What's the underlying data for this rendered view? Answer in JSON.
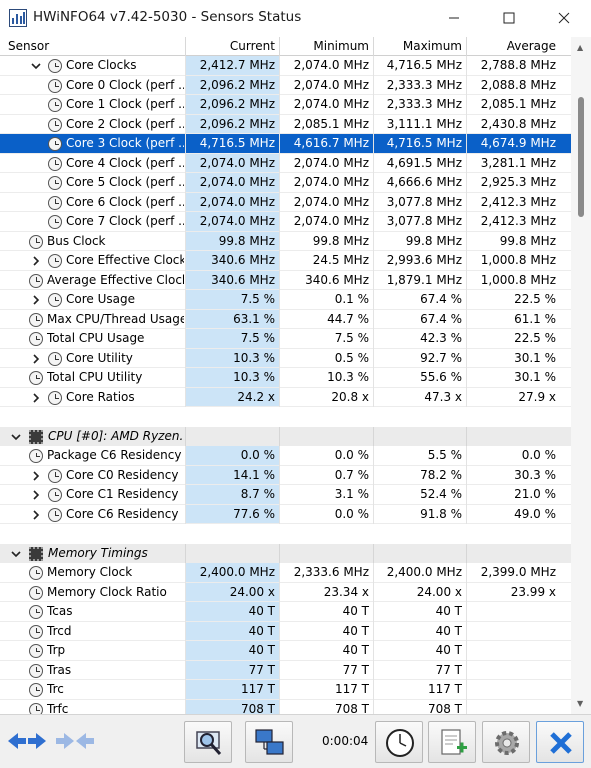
{
  "window": {
    "title": "HWiNFO64 v7.42-5030 - Sensors Status",
    "minimize_icon": "minimize-icon",
    "maximize_icon": "maximize-icon",
    "close_icon": "close-icon"
  },
  "columns": {
    "sensor": "Sensor",
    "current": "Current",
    "minimum": "Minimum",
    "maximum": "Maximum",
    "average": "Average"
  },
  "rows": [
    {
      "type": "sensor",
      "indent": 1,
      "expander": "open",
      "icon": "clock-sensor-icon",
      "name": "Core Clocks",
      "current": "2,412.7 MHz",
      "minimum": "2,074.0 MHz",
      "maximum": "4,716.5 MHz",
      "average": "2,788.8 MHz"
    },
    {
      "type": "sensor",
      "indent": 2,
      "expander": "",
      "icon": "clock-sensor-icon",
      "name": "Core 0 Clock (perf ...",
      "current": "2,096.2 MHz",
      "minimum": "2,074.0 MHz",
      "maximum": "2,333.3 MHz",
      "average": "2,088.8 MHz"
    },
    {
      "type": "sensor",
      "indent": 2,
      "expander": "",
      "icon": "clock-sensor-icon",
      "name": "Core 1 Clock (perf ...",
      "current": "2,096.2 MHz",
      "minimum": "2,074.0 MHz",
      "maximum": "2,333.3 MHz",
      "average": "2,085.1 MHz"
    },
    {
      "type": "sensor",
      "indent": 2,
      "expander": "",
      "icon": "clock-sensor-icon",
      "name": "Core 2 Clock (perf ...",
      "current": "2,096.2 MHz",
      "minimum": "2,085.1 MHz",
      "maximum": "3,111.1 MHz",
      "average": "2,430.8 MHz"
    },
    {
      "type": "sensor",
      "indent": 2,
      "expander": "",
      "icon": "clock-sensor-icon",
      "name": "Core 3 Clock (perf ...",
      "current": "4,716.5 MHz",
      "minimum": "4,616.7 MHz",
      "maximum": "4,716.5 MHz",
      "average": "4,674.9 MHz",
      "selected": true
    },
    {
      "type": "sensor",
      "indent": 2,
      "expander": "",
      "icon": "clock-sensor-icon",
      "name": "Core 4 Clock (perf ...",
      "current": "2,074.0 MHz",
      "minimum": "2,074.0 MHz",
      "maximum": "4,691.5 MHz",
      "average": "3,281.1 MHz"
    },
    {
      "type": "sensor",
      "indent": 2,
      "expander": "",
      "icon": "clock-sensor-icon",
      "name": "Core 5 Clock (perf ...",
      "current": "2,074.0 MHz",
      "minimum": "2,074.0 MHz",
      "maximum": "4,666.6 MHz",
      "average": "2,925.3 MHz"
    },
    {
      "type": "sensor",
      "indent": 2,
      "expander": "",
      "icon": "clock-sensor-icon",
      "name": "Core 6 Clock (perf ...",
      "current": "2,074.0 MHz",
      "minimum": "2,074.0 MHz",
      "maximum": "3,077.8 MHz",
      "average": "2,412.3 MHz"
    },
    {
      "type": "sensor",
      "indent": 2,
      "expander": "",
      "icon": "clock-sensor-icon",
      "name": "Core 7 Clock (perf ...",
      "current": "2,074.0 MHz",
      "minimum": "2,074.0 MHz",
      "maximum": "3,077.8 MHz",
      "average": "2,412.3 MHz"
    },
    {
      "type": "sensor",
      "indent": 0,
      "expander": "",
      "icon": "clock-sensor-icon",
      "name": "Bus Clock",
      "current": "99.8 MHz",
      "minimum": "99.8 MHz",
      "maximum": "99.8 MHz",
      "average": "99.8 MHz"
    },
    {
      "type": "sensor",
      "indent": 1,
      "expander": "closed",
      "icon": "clock-sensor-icon",
      "name": "Core Effective Clocks",
      "current": "340.6 MHz",
      "minimum": "24.5 MHz",
      "maximum": "2,993.6 MHz",
      "average": "1,000.8 MHz"
    },
    {
      "type": "sensor",
      "indent": 0,
      "expander": "",
      "icon": "clock-sensor-icon",
      "name": "Average Effective Clock",
      "current": "340.6 MHz",
      "minimum": "340.6 MHz",
      "maximum": "1,879.1 MHz",
      "average": "1,000.8 MHz"
    },
    {
      "type": "sensor",
      "indent": 1,
      "expander": "closed",
      "icon": "clock-sensor-icon",
      "name": "Core Usage",
      "current": "7.5 %",
      "minimum": "0.1 %",
      "maximum": "67.4 %",
      "average": "22.5 %"
    },
    {
      "type": "sensor",
      "indent": 0,
      "expander": "",
      "icon": "clock-sensor-icon",
      "name": "Max CPU/Thread Usage",
      "current": "63.1 %",
      "minimum": "44.7 %",
      "maximum": "67.4 %",
      "average": "61.1 %"
    },
    {
      "type": "sensor",
      "indent": 0,
      "expander": "",
      "icon": "clock-sensor-icon",
      "name": "Total CPU Usage",
      "current": "7.5 %",
      "minimum": "7.5 %",
      "maximum": "42.3 %",
      "average": "22.5 %"
    },
    {
      "type": "sensor",
      "indent": 1,
      "expander": "closed",
      "icon": "clock-sensor-icon",
      "name": "Core Utility",
      "current": "10.3 %",
      "minimum": "0.5 %",
      "maximum": "92.7 %",
      "average": "30.1 %"
    },
    {
      "type": "sensor",
      "indent": 0,
      "expander": "",
      "icon": "clock-sensor-icon",
      "name": "Total CPU Utility",
      "current": "10.3 %",
      "minimum": "10.3 %",
      "maximum": "55.6 %",
      "average": "30.1 %"
    },
    {
      "type": "sensor",
      "indent": 1,
      "expander": "closed",
      "icon": "clock-sensor-icon",
      "name": "Core Ratios",
      "current": "24.2 x",
      "minimum": "20.8 x",
      "maximum": "47.3 x",
      "average": "27.9 x"
    },
    {
      "type": "blank"
    },
    {
      "type": "group",
      "expander": "open",
      "icon": "chip-icon",
      "name": "CPU [#0]: AMD Ryzen..."
    },
    {
      "type": "sensor",
      "indent": 0,
      "expander": "",
      "icon": "clock-sensor-icon",
      "name": "Package C6 Residency",
      "current": "0.0 %",
      "minimum": "0.0 %",
      "maximum": "5.5 %",
      "average": "0.0 %"
    },
    {
      "type": "sensor",
      "indent": 1,
      "expander": "closed",
      "icon": "clock-sensor-icon",
      "name": "Core C0 Residency",
      "current": "14.1 %",
      "minimum": "0.7 %",
      "maximum": "78.2 %",
      "average": "30.3 %"
    },
    {
      "type": "sensor",
      "indent": 1,
      "expander": "closed",
      "icon": "clock-sensor-icon",
      "name": "Core C1 Residency",
      "current": "8.7 %",
      "minimum": "3.1 %",
      "maximum": "52.4 %",
      "average": "21.0 %"
    },
    {
      "type": "sensor",
      "indent": 1,
      "expander": "closed",
      "icon": "clock-sensor-icon",
      "name": "Core C6 Residency",
      "current": "77.6 %",
      "minimum": "0.0 %",
      "maximum": "91.8 %",
      "average": "49.0 %"
    },
    {
      "type": "blank"
    },
    {
      "type": "group",
      "expander": "open",
      "icon": "chip-icon",
      "name": "Memory Timings"
    },
    {
      "type": "sensor",
      "indent": 0,
      "expander": "",
      "icon": "clock-sensor-icon",
      "name": "Memory Clock",
      "current": "2,400.0 MHz",
      "minimum": "2,333.6 MHz",
      "maximum": "2,400.0 MHz",
      "average": "2,399.0 MHz"
    },
    {
      "type": "sensor",
      "indent": 0,
      "expander": "",
      "icon": "clock-sensor-icon",
      "name": "Memory Clock Ratio",
      "current": "24.00 x",
      "minimum": "23.34 x",
      "maximum": "24.00 x",
      "average": "23.99 x"
    },
    {
      "type": "sensor",
      "indent": 0,
      "expander": "",
      "icon": "clock-sensor-icon",
      "name": "Tcas",
      "current": "40 T",
      "minimum": "40 T",
      "maximum": "40 T",
      "average": ""
    },
    {
      "type": "sensor",
      "indent": 0,
      "expander": "",
      "icon": "clock-sensor-icon",
      "name": "Trcd",
      "current": "40 T",
      "minimum": "40 T",
      "maximum": "40 T",
      "average": ""
    },
    {
      "type": "sensor",
      "indent": 0,
      "expander": "",
      "icon": "clock-sensor-icon",
      "name": "Trp",
      "current": "40 T",
      "minimum": "40 T",
      "maximum": "40 T",
      "average": ""
    },
    {
      "type": "sensor",
      "indent": 0,
      "expander": "",
      "icon": "clock-sensor-icon",
      "name": "Tras",
      "current": "77 T",
      "minimum": "77 T",
      "maximum": "77 T",
      "average": ""
    },
    {
      "type": "sensor",
      "indent": 0,
      "expander": "",
      "icon": "clock-sensor-icon",
      "name": "Trc",
      "current": "117 T",
      "minimum": "117 T",
      "maximum": "117 T",
      "average": ""
    },
    {
      "type": "sensor",
      "indent": 0,
      "expander": "",
      "icon": "clock-sensor-icon",
      "name": "Trfc",
      "current": "708 T",
      "minimum": "708 T",
      "maximum": "708 T",
      "average": ""
    }
  ],
  "toolbar": {
    "nav_left_icon": "expand-arrows-icon",
    "nav_right_icon": "collapse-arrows-icon",
    "search_icon": "magnifier-monitor-icon",
    "network_icon": "network-monitors-icon",
    "elapsed_time": "0:00:04",
    "clock_icon": "clock-reset-icon",
    "report_icon": "add-report-icon",
    "settings_icon": "gear-icon",
    "close_icon": "close-x-icon"
  },
  "colors": {
    "selection": "#0a60c8",
    "current_column": "#cce4f7",
    "group_row": "#ebebeb"
  }
}
